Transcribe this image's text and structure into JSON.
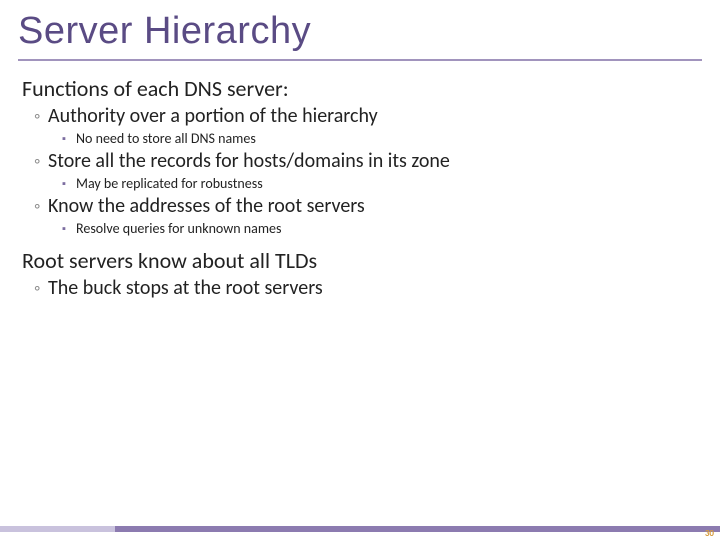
{
  "title": "Server Hierarchy",
  "section1": {
    "heading": "Functions of each DNS server:",
    "items": [
      {
        "text": "Authority over a portion of the hierarchy",
        "sub": [
          "No need to store all DNS names"
        ]
      },
      {
        "text": "Store all the records for hosts/domains in its zone",
        "sub": [
          "May be replicated for robustness"
        ]
      },
      {
        "text": "Know the addresses of the root servers",
        "sub": [
          "Resolve queries for unknown names"
        ]
      }
    ]
  },
  "section2": {
    "heading": "Root servers know about all TLDs",
    "items": [
      {
        "text": "The buck stops at the root servers"
      }
    ]
  },
  "page_number": "30"
}
